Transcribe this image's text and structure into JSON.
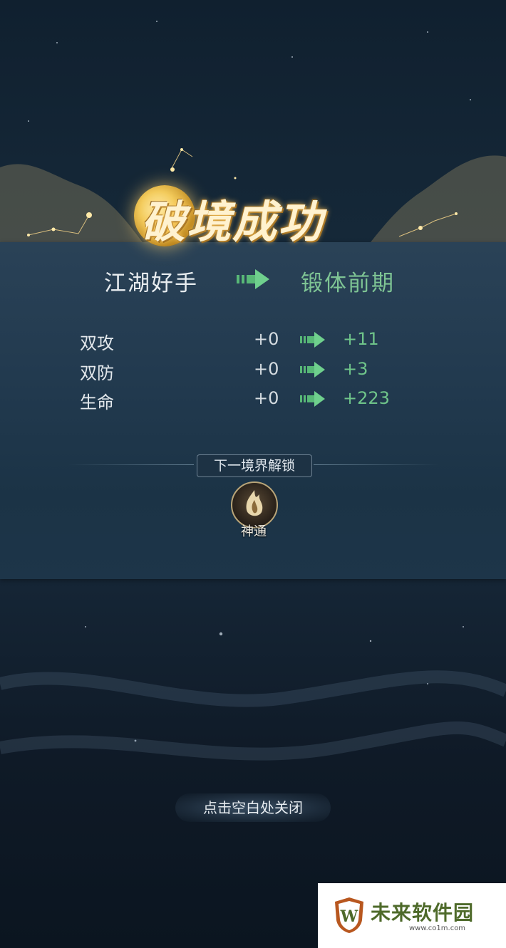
{
  "title": "破境成功",
  "rank": {
    "from": "江湖好手",
    "to": "锻体前期"
  },
  "stats": [
    {
      "name": "双攻",
      "old": "+0",
      "new": "+11"
    },
    {
      "name": "双防",
      "old": "+0",
      "new": "+3"
    },
    {
      "name": "生命",
      "old": "+0",
      "new": "+223"
    }
  ],
  "unlock": {
    "label": "下一境界解锁",
    "skill_name": "神通",
    "skill_icon": "flame-spirit-icon"
  },
  "close_hint": "点击空白处关闭",
  "watermark": {
    "name": "未来软件园",
    "url": "www.co1m.com"
  },
  "colors": {
    "gain_green": "#6fc48a",
    "title_gold": "#f3cb5c",
    "panel": "#223a4f"
  }
}
